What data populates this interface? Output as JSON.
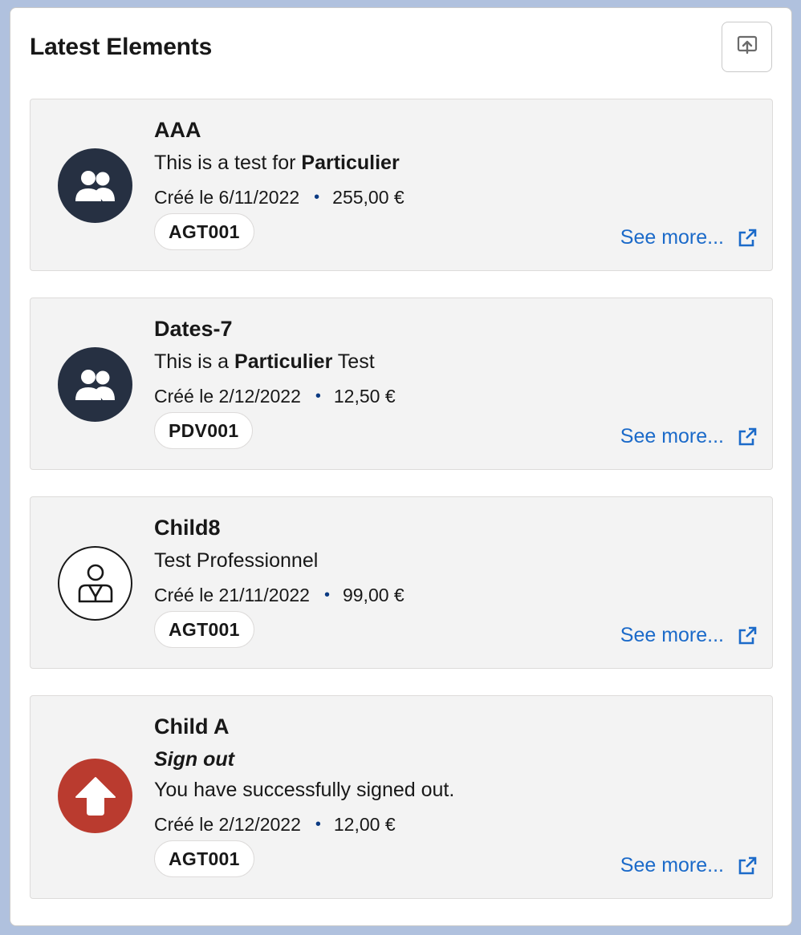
{
  "header": {
    "title": "Latest Elements",
    "action_icon": "share-icon"
  },
  "items": [
    {
      "title": "AAA",
      "description": {
        "before": "This is a test for ",
        "bold": "Particulier",
        "after": ""
      },
      "date": "Créé le 6/11/2022",
      "amount": "255,00 €",
      "badge": "AGT001",
      "icon": "people-icon",
      "link": "See more..."
    },
    {
      "title": "Dates-7",
      "description": {
        "before": "This is a ",
        "bold": "Particulier",
        "after": " Test"
      },
      "date": "Créé le 2/12/2022",
      "amount": "12,50 €",
      "badge": "PDV001",
      "icon": "people-icon",
      "link": "See more..."
    },
    {
      "title": "Child8",
      "description": {
        "before": "Test Professionnel",
        "bold": "",
        "after": ""
      },
      "date": "Créé le 21/11/2022",
      "amount": "99,00 €",
      "badge": "AGT001",
      "icon": "user-icon",
      "link": "See more..."
    },
    {
      "title": "Child A",
      "subtitle": "Sign out",
      "description": {
        "before": "You have successfully signed out.",
        "bold": "",
        "after": ""
      },
      "date": "Créé le 2/12/2022",
      "amount": "12,00 €",
      "badge": "AGT001",
      "icon": "arrow-up-icon",
      "link": "See more..."
    }
  ],
  "colors": {
    "link": "#1b6ac9",
    "avatar_dark": "#263042",
    "avatar_red": "#ba3b2f",
    "tile_bg": "#f3f3f3"
  }
}
